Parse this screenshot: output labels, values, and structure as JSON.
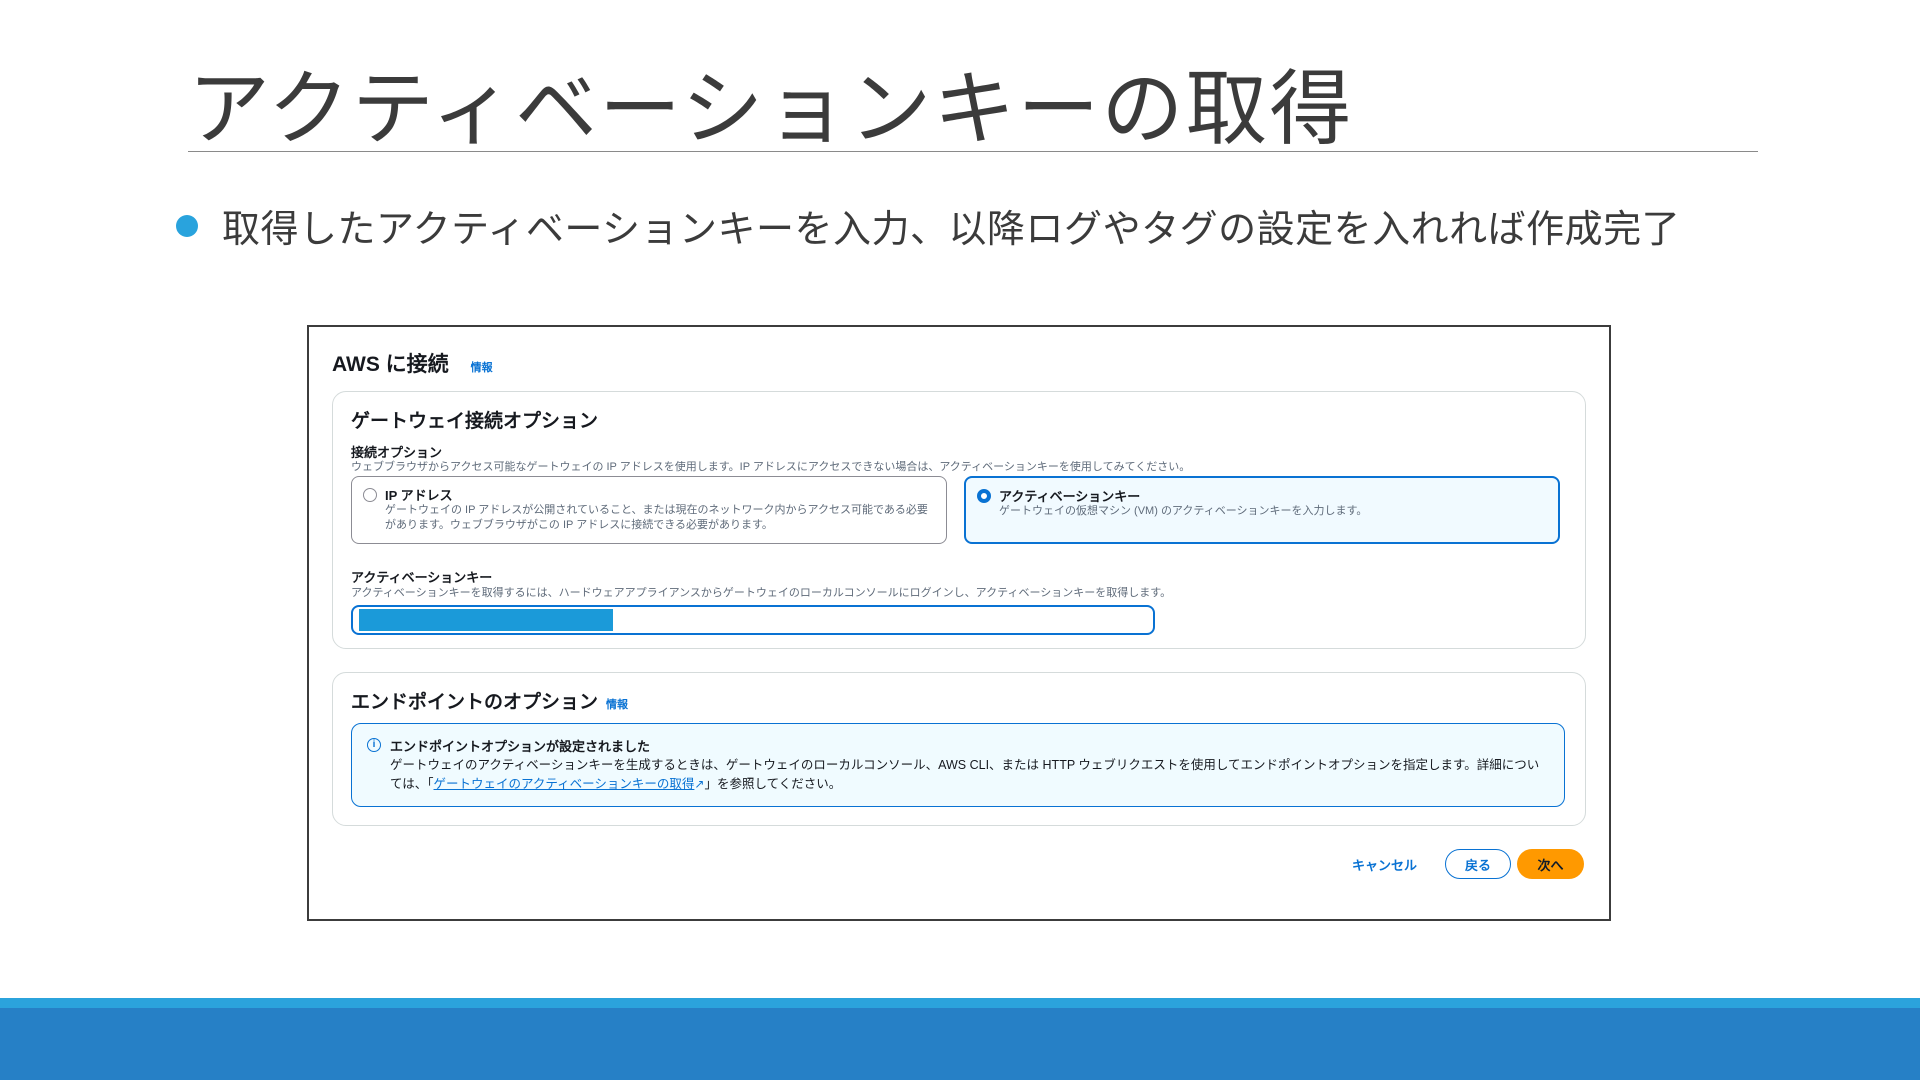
{
  "slide": {
    "title": "アクティベーションキーの取得",
    "bullet": "取得したアクティベーションキーを入力、以降ログやタグの設定を入れれば作成完了"
  },
  "console": {
    "header_title": "AWS に接続",
    "info_label": "情報",
    "gateway_section": {
      "heading": "ゲートウェイ接続オプション",
      "connection_label": "接続オプション",
      "connection_desc": "ウェブブラウザからアクセス可能なゲートウェイの IP アドレスを使用します。IP アドレスにアクセスできない場合は、アクティベーションキーを使用してみてください。",
      "options": [
        {
          "title": "IP アドレス",
          "desc": "ゲートウェイの IP アドレスが公開されていること、または現在のネットワーク内からアクセス可能である必要があります。ウェブブラウザがこの IP アドレスに接続できる必要があります。",
          "selected": false
        },
        {
          "title": "アクティベーションキー",
          "desc": "ゲートウェイの仮想マシン (VM) のアクティベーションキーを入力します。",
          "selected": true
        }
      ],
      "key_label": "アクティベーションキー",
      "key_desc": "アクティベーションキーを取得するには、ハードウェアアプライアンスからゲートウェイのローカルコンソールにログインし、アクティベーションキーを取得します。"
    },
    "endpoint_section": {
      "heading": "エンドポイントのオプション",
      "info_label": "情報",
      "alert_title": "エンドポイントオプションが設定されました",
      "alert_body_before": "ゲートウェイのアクティベーションキーを生成するときは、ゲートウェイのローカルコンソール、AWS CLI、または HTTP ウェブリクエストを使用してエンドポイントオプションを指定します。詳細については、「",
      "alert_link": "ゲートウェイのアクティベーションキーの取得",
      "alert_body_after": "」を参照してください。"
    },
    "buttons": {
      "cancel": "キャンセル",
      "back": "戻る",
      "next": "次へ"
    }
  },
  "colors": {
    "accent": "#0972d3",
    "primary_button": "#ff9900",
    "footer_light": "#2ba3dc",
    "footer_dark": "#2680c6",
    "bullet": "#29a3dd"
  }
}
